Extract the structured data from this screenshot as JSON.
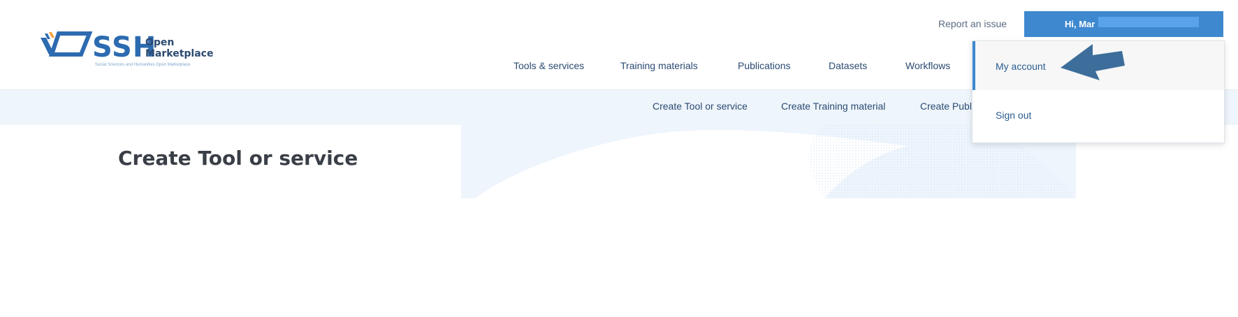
{
  "header": {
    "logo": {
      "brand": "SSH",
      "line1": "Open",
      "line2": "Marketplace",
      "tagline": "Social Sciences and Humanities Open Marketplace"
    },
    "report_link": "Report an issue",
    "user_button": {
      "greeting": "Hi, Mar"
    },
    "main_nav": [
      "Tools & services",
      "Training materials",
      "Publications",
      "Datasets",
      "Workflows"
    ]
  },
  "subnav": [
    "Create Tool or service",
    "Create Training material",
    "Create Publ"
  ],
  "page": {
    "title": "Create Tool or service"
  },
  "dropdown": {
    "items": [
      "My account",
      "Sign out"
    ],
    "active": "My account"
  },
  "colors": {
    "brand_blue": "#3e88cf",
    "nav_text": "#2b4a72",
    "subnav_bg": "#eef5fb",
    "arrow": "#3d6e9b"
  }
}
